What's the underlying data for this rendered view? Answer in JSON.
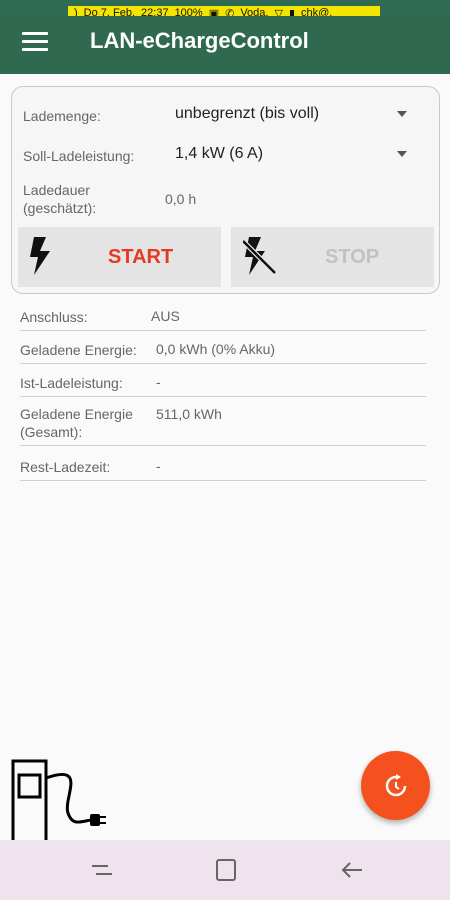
{
  "status_bar": {
    "moon": ")",
    "date": "Do 7. Feb.",
    "time": "22:37",
    "battery": "100%",
    "carrier": "Voda.",
    "network": "chk@."
  },
  "app_bar": {
    "title": "LAN-eChargeControl",
    "menu_icon": "hamburger-icon"
  },
  "settings": {
    "amount_label": "Lademenge:",
    "amount_value": "unbegrenzt (bis voll)",
    "power_label": "Soll-Ladeleistung:",
    "power_value": "1,4 kW (6 A)",
    "duration_label_1": "Ladedauer",
    "duration_label_2": "(geschätzt):",
    "duration_value": "0,0 h"
  },
  "buttons": {
    "start_label": "START",
    "stop_label": "STOP",
    "start_icon": "lightning-icon",
    "stop_icon": "lightning-off-icon"
  },
  "info": [
    {
      "label": "Anschluss:",
      "value": "AUS"
    },
    {
      "label": "Geladene Energie:",
      "value": "0,0 kWh (0% Akku)"
    },
    {
      "label": "Ist-Ladeleistung:",
      "value": "-"
    },
    {
      "label": "Geladene Energie",
      "label2": "(Gesamt):",
      "value": "511,0 kWh"
    },
    {
      "label": "Rest-Ladezeit:",
      "value": "-"
    }
  ],
  "colors": {
    "primary": "#2f6a50",
    "accent": "#f4511e",
    "start": "#e53a21",
    "stop_disabled": "#c2c2c2"
  },
  "fab_icon": "refresh-icon",
  "nav": [
    "recents-icon",
    "home-icon",
    "back-icon"
  ]
}
